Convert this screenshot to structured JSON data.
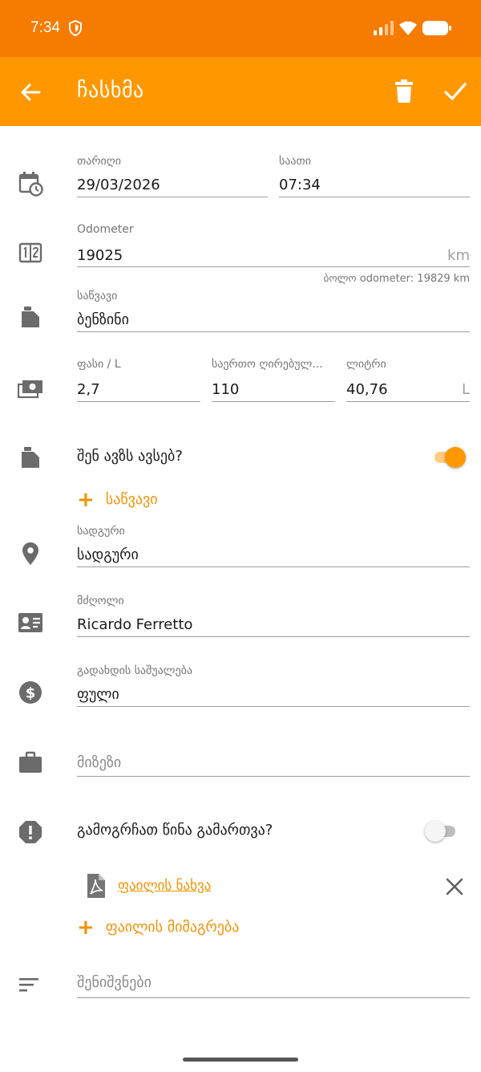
{
  "status_bar": {
    "time": "7:34",
    "icons": [
      "shield-icon",
      "signal-icon",
      "wifi-icon",
      "battery-icon"
    ]
  },
  "app_bar": {
    "title": "ჩასხმა",
    "icons": [
      "back-arrow-icon",
      "delete-icon",
      "check-icon"
    ],
    "color": "#ff9800",
    "status_color": "#f57c00"
  },
  "form": {
    "date": {
      "label": "თარიღი",
      "value": "29/03/2026"
    },
    "time": {
      "label": "საათი",
      "value": "07:34"
    },
    "odometer": {
      "label": "Odometer",
      "value": "19025",
      "unit": "km",
      "helper": "ბოლო odometer: 19829 km"
    },
    "fuel": {
      "label": "საწვავი",
      "value": "ბენზინი"
    },
    "price": {
      "label": "ფასი / L",
      "value": "2,7"
    },
    "total_cost": {
      "label": "საერთო ღირებულ...",
      "value": "110"
    },
    "liters": {
      "label": "ლიტრი",
      "value": "40,76",
      "unit": "L"
    },
    "full_tank": {
      "label": "შენ ავზს ავსებ?",
      "on": true
    },
    "add_fuel": {
      "label": "საწვავი"
    },
    "station": {
      "label": "სადგური",
      "value": "სადგური"
    },
    "driver": {
      "label": "მძღოლი",
      "value": "Ricardo Ferretto"
    },
    "payment": {
      "label": "გადახდის საშუალება",
      "value": "ფული"
    },
    "reason": {
      "placeholder": "მიზეზი"
    },
    "missed_previous": {
      "label": "გამოგრჩათ წინა გამართვა?",
      "on": false
    },
    "attachment": {
      "link": "ფაილის ნახვა"
    },
    "attach_file": {
      "label": "ფაილის მიმაგრება"
    },
    "notes": {
      "placeholder": "შენიშვნები"
    }
  },
  "colors": {
    "accent": "#f39200",
    "toggle_on": "#ff9800",
    "icon_grey": "#6b6b6b"
  }
}
